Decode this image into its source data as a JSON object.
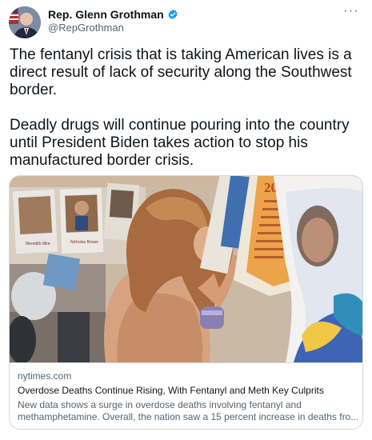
{
  "author": {
    "display_name": "Rep. Glenn Grothman",
    "handle": "@RepGrothman",
    "avatar_icon": "avatar-photo-icon",
    "verified_color": "#1d9bf0"
  },
  "menu": {
    "more_label": "···"
  },
  "tweet": {
    "paragraph_1": "The fentanyl crisis that is taking American lives is a direct result of lack of security along the Southwest border.",
    "paragraph_2": "Deadly drugs will continue pouring into the country until President Biden takes action to stop his manufactured border crisis."
  },
  "link_card": {
    "domain": "nytimes.com",
    "title": "Overdose Deaths Continue Rising, With Fentanyl and Meth Key Culprits",
    "description_line_1": "New data shows a surge in overdose deaths involving fentanyl and",
    "description_line_2": "methamphetamine. Overall, the nation saw a 15 percent increase in deaths fro...",
    "image": {
      "poster_year": "2021",
      "poster_caption_1": "Meredith Mire",
      "poster_caption_2": "Nicholas Brown"
    }
  },
  "colors": {
    "text_primary": "#0f1419",
    "text_secondary": "#536471",
    "border": "#cfd9de",
    "accent": "#1d9bf0"
  }
}
